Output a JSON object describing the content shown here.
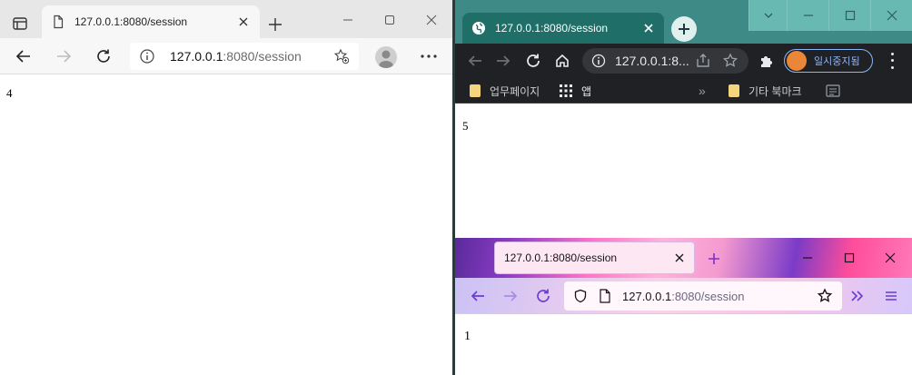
{
  "edge": {
    "tab": {
      "title": "127.0.0.1:8080/session"
    },
    "address": {
      "host": "127.0.0.1",
      "rest": ":8080/session"
    },
    "page": {
      "body": "4"
    },
    "icons": [
      "tab-actions-icon",
      "page-icon",
      "close-icon",
      "plus-icon",
      "minimize-icon",
      "maximize-icon",
      "back-icon",
      "forward-icon",
      "reload-icon",
      "info-icon",
      "add-favorite-icon",
      "avatar",
      "more-icon"
    ]
  },
  "chrome": {
    "tab": {
      "title": "127.0.0.1:8080/session"
    },
    "address": {
      "text": "127.0.0.1:8..."
    },
    "profile": {
      "label": "일시중지됨"
    },
    "bookmarks": {
      "business": "업무페이지",
      "apps": "앱",
      "overflow": "»",
      "other": "기타 북마크"
    },
    "page": {
      "body": "5"
    },
    "theme": {
      "frame": "#3e8a86",
      "active_tab": "#1f6e67",
      "toolbar": "#202124"
    }
  },
  "firefox": {
    "tab": {
      "title": "127.0.0.1:8080/session"
    },
    "address": {
      "host": "127.0.0.1",
      "rest": ":8080/session"
    },
    "page": {
      "body": "1"
    }
  }
}
